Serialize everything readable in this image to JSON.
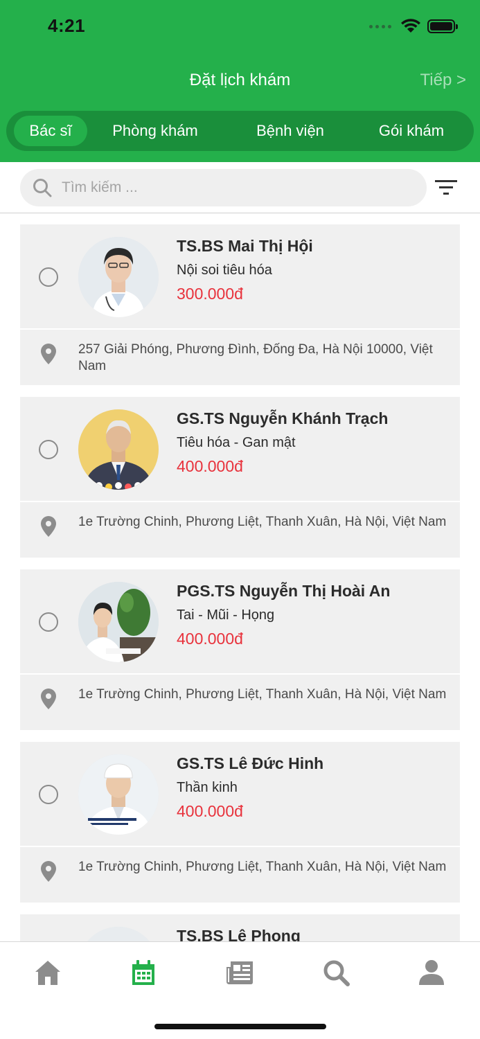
{
  "status_bar": {
    "time": "4:21"
  },
  "header": {
    "title": "Đặt lịch khám",
    "next_label": "Tiếp >"
  },
  "segments": [
    "Bác sĩ",
    "Phòng khám",
    "Bệnh viện",
    "Gói khám"
  ],
  "active_segment": 0,
  "search": {
    "placeholder": "Tìm kiếm ..."
  },
  "doctors": [
    {
      "name": "TS.BS Mai Thị Hội",
      "specialty": "Nội soi tiêu hóa",
      "price": "300.000đ",
      "address": "257 Giải Phóng, Phương Đình, Đống Đa, Hà Nội 10000, Việt Nam"
    },
    {
      "name": "GS.TS Nguyễn Khánh Trạch",
      "specialty": "Tiêu hóa - Gan mật",
      "price": "400.000đ",
      "address": "1e Trường Chinh, Phương Liệt, Thanh Xuân, Hà Nội, Việt Nam"
    },
    {
      "name": "PGS.TS Nguyễn Thị Hoài An",
      "specialty": "Tai - Mũi - Họng",
      "price": "400.000đ",
      "address": "1e Trường Chinh, Phương Liệt, Thanh Xuân, Hà Nội, Việt Nam"
    },
    {
      "name": "GS.TS Lê Đức Hinh",
      "specialty": "Thần kinh",
      "price": "400.000đ",
      "address": "1e Trường Chinh, Phương Liệt, Thanh Xuân, Hà Nội, Việt Nam"
    },
    {
      "name": "TS.BS Lê Phong"
    }
  ],
  "tabs": [
    {
      "icon": "home-icon"
    },
    {
      "icon": "calendar-icon",
      "active": true
    },
    {
      "icon": "news-icon"
    },
    {
      "icon": "search-icon"
    },
    {
      "icon": "profile-icon"
    }
  ],
  "colors": {
    "brand": "#24b04b",
    "brand_dark": "#1a8f3b",
    "price": "#e8323c",
    "inactive_icon": "#8c8c8c"
  }
}
